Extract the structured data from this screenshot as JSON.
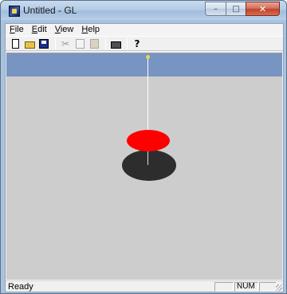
{
  "window": {
    "title": "Untitled - GL",
    "app_icon": "opengl-app-icon",
    "controls": {
      "minimize_glyph": "–",
      "maximize_glyph": "□",
      "close_glyph": "✕"
    }
  },
  "menubar": {
    "items": [
      {
        "label": "File",
        "accelerator": "F"
      },
      {
        "label": "Edit",
        "accelerator": "E"
      },
      {
        "label": "View",
        "accelerator": "V"
      },
      {
        "label": "Help",
        "accelerator": "H"
      }
    ]
  },
  "toolbar": {
    "buttons": [
      {
        "icon": "new-document-icon",
        "enabled": true
      },
      {
        "icon": "open-folder-icon",
        "enabled": true
      },
      {
        "icon": "save-disk-icon",
        "enabled": true
      },
      {
        "icon": "cut-scissors-icon",
        "enabled": false
      },
      {
        "icon": "copy-icon",
        "enabled": false
      },
      {
        "icon": "paste-icon",
        "enabled": false
      },
      {
        "icon": "print-icon",
        "enabled": true
      },
      {
        "icon": "help-icon",
        "enabled": true,
        "glyph": "?"
      }
    ]
  },
  "scene": {
    "background_color": "#cdcdcd",
    "sky_color": "#7894c2",
    "disc_color": "#ff0000",
    "shadow_color": "#2d2d2d",
    "string_color": "#ffffff"
  },
  "statusbar": {
    "message": "Ready",
    "panes": [
      "",
      "NUM",
      ""
    ]
  }
}
